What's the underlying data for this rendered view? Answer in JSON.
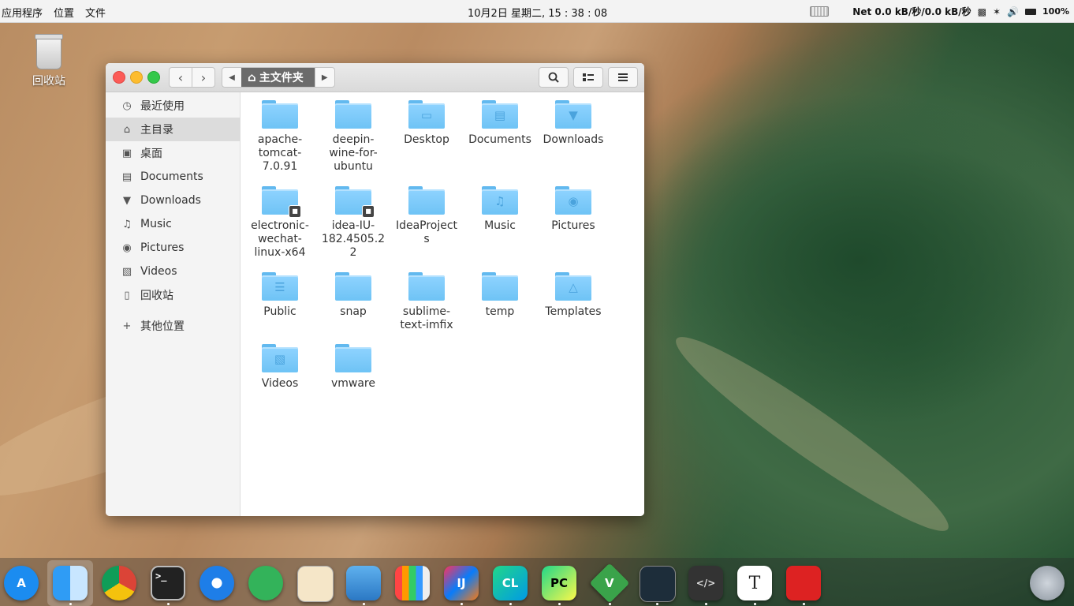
{
  "topbar": {
    "menu": [
      "应用程序",
      "位置",
      "文件"
    ],
    "clock": "10月2日 星期二, 15 : 38 : 08",
    "network": "Net 0.0 kB/秒/0.0 kB/秒",
    "battery": "100%"
  },
  "desktop": {
    "trash_label": "回收站"
  },
  "window": {
    "breadcrumb_current": "主文件夹",
    "sidebar": [
      {
        "label": "最近使用",
        "icon": "recent-icon"
      },
      {
        "label": "主目录",
        "icon": "home-icon",
        "active": true
      },
      {
        "label": "桌面",
        "icon": "desktop-icon"
      },
      {
        "label": "Documents",
        "icon": "documents-icon"
      },
      {
        "label": "Downloads",
        "icon": "downloads-icon"
      },
      {
        "label": "Music",
        "icon": "music-icon"
      },
      {
        "label": "Pictures",
        "icon": "camera-icon"
      },
      {
        "label": "Videos",
        "icon": "film-icon"
      },
      {
        "label": "回收站",
        "icon": "trash-icon"
      },
      {
        "label": "其他位置",
        "icon": "plus-icon"
      }
    ],
    "files": [
      {
        "name": "apache-tomcat-7.0.91",
        "lines": [
          "apache-",
          "tomcat-",
          "7.0.91"
        ]
      },
      {
        "name": "deepin-wine-for-ubuntu",
        "lines": [
          "deepin-",
          "wine-for-",
          "ubuntu"
        ]
      },
      {
        "name": "Desktop",
        "lines": [
          "Desktop"
        ]
      },
      {
        "name": "Documents",
        "lines": [
          "Documents"
        ]
      },
      {
        "name": "Downloads",
        "lines": [
          "Downloads"
        ]
      },
      {
        "name": "electronic-wechat-linux-x64",
        "lines": [
          "electronic-",
          "wechat-",
          "linux-x64"
        ]
      },
      {
        "name": "idea-IU-182.4505.22",
        "lines": [
          "idea-IU-",
          "182.4505.2",
          "2"
        ]
      },
      {
        "name": "IdeaProjects",
        "lines": [
          "IdeaProject",
          "s"
        ]
      },
      {
        "name": "Music",
        "lines": [
          "Music"
        ]
      },
      {
        "name": "Pictures",
        "lines": [
          "Pictures"
        ]
      },
      {
        "name": "Public",
        "lines": [
          "Public"
        ]
      },
      {
        "name": "snap",
        "lines": [
          "snap"
        ]
      },
      {
        "name": "sublime-text-imfix",
        "lines": [
          "sublime-",
          "text-imfix"
        ]
      },
      {
        "name": "temp",
        "lines": [
          "temp"
        ]
      },
      {
        "name": "Templates",
        "lines": [
          "Templates"
        ]
      },
      {
        "name": "Videos",
        "lines": [
          "Videos"
        ]
      },
      {
        "name": "vmware",
        "lines": [
          "vmware"
        ]
      }
    ]
  },
  "dock": {
    "apps": [
      {
        "name": "app-store",
        "label": "A"
      },
      {
        "name": "finder",
        "label": ""
      },
      {
        "name": "chrome",
        "label": ""
      },
      {
        "name": "terminal",
        "label": ">_"
      },
      {
        "name": "deepin-browser",
        "label": ""
      },
      {
        "name": "telegram",
        "label": ""
      },
      {
        "name": "text-editor",
        "label": ""
      },
      {
        "name": "keynote",
        "label": ""
      },
      {
        "name": "numbers",
        "label": ""
      },
      {
        "name": "intellij-idea",
        "label": "IJ"
      },
      {
        "name": "clion",
        "label": "CL"
      },
      {
        "name": "pycharm",
        "label": "PC"
      },
      {
        "name": "vim",
        "label": "V"
      },
      {
        "name": "system-monitor",
        "label": ""
      },
      {
        "name": "sublime-text",
        "label": "</>"
      },
      {
        "name": "typora",
        "label": "T"
      },
      {
        "name": "netease-music",
        "label": ""
      },
      {
        "name": "launchpad",
        "label": ""
      }
    ]
  }
}
